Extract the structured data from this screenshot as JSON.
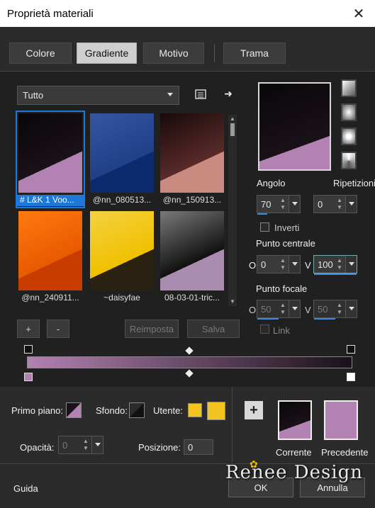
{
  "window": {
    "title": "Proprietà materiali"
  },
  "tabs": [
    {
      "label": "Colore"
    },
    {
      "label": "Gradiente"
    },
    {
      "label": "Motivo"
    },
    {
      "label": "Trama"
    }
  ],
  "library": {
    "category": "Tutto",
    "swatches": [
      {
        "label": "# L&K 1 Voo...",
        "colors": [
          "#090709",
          "#1a1119",
          "#b282b2"
        ]
      },
      {
        "label": "@nn_080513...",
        "colors": [
          "#3656a4",
          "#1f3f88",
          "#0e2a6e"
        ]
      },
      {
        "label": "@nn_150913...",
        "colors": [
          "#180a0a",
          "#5a2a2a",
          "#c98a80"
        ]
      },
      {
        "label": "@nn_240911...",
        "colors": [
          "#ff7a10",
          "#e85a00",
          "#c83c00"
        ]
      },
      {
        "label": "~daisyfae",
        "colors": [
          "#f3d240",
          "#f0c000",
          "#2a2210"
        ]
      },
      {
        "label": "08-03-01-tric...",
        "colors": [
          "#7a7a7a",
          "#101010",
          "#a98cb0"
        ]
      }
    ]
  },
  "buttons": {
    "add": "+",
    "remove": "-",
    "reset": "Reimposta",
    "save": "Salva",
    "ok": "OK",
    "cancel": "Annulla",
    "help": "Guida"
  },
  "gradient": {
    "angle_label": "Angolo",
    "angle_value": "70",
    "repeats_label": "Ripetizioni",
    "repeats_value": "0",
    "invert_label": "Inverti",
    "center_label": "Punto centrale",
    "center_o": "0",
    "center_v": "100",
    "focal_label": "Punto focale",
    "focal_o": "50",
    "focal_v": "50",
    "link_label": "Link",
    "o_label": "O",
    "v_label": "V"
  },
  "bottom": {
    "foreground_label": "Primo piano:",
    "background_label": "Sfondo:",
    "user_label": "Utente:",
    "opacity_label": "Opacità:",
    "opacity_value": "0",
    "position_label": "Posizione:",
    "position_value": "0",
    "current_label": "Corrente",
    "previous_label": "Precedente",
    "previous_color": "#b282b2",
    "user_color": "#f3c31e"
  },
  "watermark": "Renee Design"
}
